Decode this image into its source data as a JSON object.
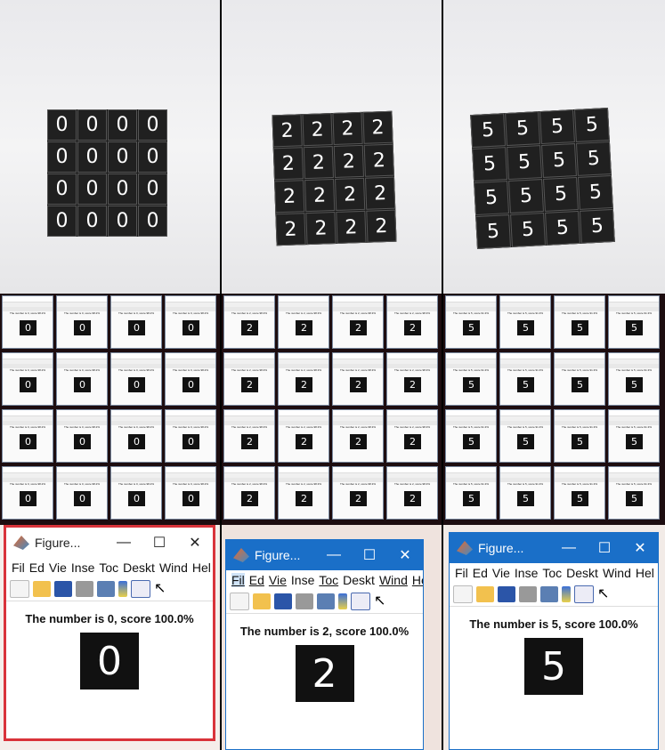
{
  "photos": [
    {
      "digits": [
        "0",
        "0",
        "0",
        "0",
        "0",
        "0",
        "0",
        "0",
        "0",
        "0",
        "0",
        "0",
        "0",
        "0",
        "0",
        "0"
      ]
    },
    {
      "digits": [
        "2",
        "2",
        "2",
        "2",
        "2",
        "2",
        "2",
        "2",
        "2",
        "2",
        "2",
        "2",
        "2",
        "2",
        "2",
        "2"
      ]
    },
    {
      "digits": [
        "5",
        "5",
        "5",
        "5",
        "5",
        "5",
        "5",
        "5",
        "5",
        "5",
        "5",
        "5",
        "5",
        "5",
        "5",
        "5"
      ]
    }
  ],
  "montage_windows": [
    {
      "digit": "0",
      "text": "The number is 0, score 98.2%"
    },
    {
      "digit": "2",
      "text": "The number is 2, score 98.3%"
    },
    {
      "digit": "5",
      "text": "The number is 5, score 91.3%"
    }
  ],
  "figures": [
    {
      "title": "Figure...",
      "menu": [
        "Fil",
        "Ed",
        "Vie",
        "Inse",
        "Toc",
        "Deskt",
        "Wind",
        "Hel"
      ],
      "caption": "The number is 0, score 100.0%",
      "digit": "0",
      "min": "—",
      "max": "☐",
      "close": "✕"
    },
    {
      "title": "Figure...",
      "menu": [
        "Fil",
        "Ed",
        "Vie",
        "Inse",
        "Toc",
        "Deskt",
        "Wind",
        "Hel"
      ],
      "caption": "The number is 2, score 100.0%",
      "digit": "2",
      "min": "—",
      "max": "☐",
      "close": "✕"
    },
    {
      "title": "Figure...",
      "menu": [
        "Fil",
        "Ed",
        "Vie",
        "Inse",
        "Toc",
        "Deskt",
        "Wind",
        "Hel"
      ],
      "caption": "The number is 5, score 100.0%",
      "digit": "5",
      "min": "—",
      "max": "☐",
      "close": "✕"
    }
  ],
  "colors": {
    "accent": "#1a6fc8",
    "border_red": "#d9333a"
  }
}
